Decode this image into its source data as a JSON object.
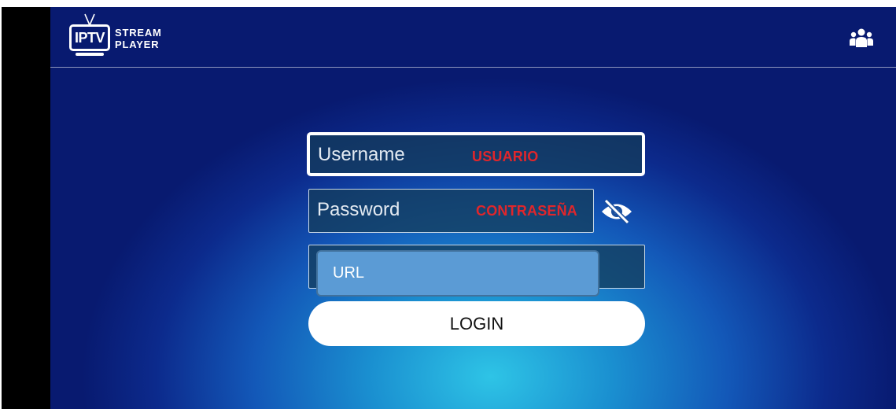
{
  "header": {
    "logo": {
      "badge": "IPTV",
      "line1": "STREAM",
      "line2": "PLAYER"
    },
    "users_icon": "users-group-icon"
  },
  "form": {
    "username": {
      "placeholder": "Username",
      "annotation": "USUARIO"
    },
    "password": {
      "placeholder": "Password",
      "annotation": "CONTRASEÑA",
      "toggle_icon": "eye-slash-icon"
    },
    "url": {
      "callout_label": "URL"
    },
    "login_label": "LOGIN"
  },
  "colors": {
    "annotation_red": "#e0262b",
    "callout_fill": "#5b9bd5",
    "background_center": "#2ec4e6",
    "background_edge": "#081a70"
  }
}
